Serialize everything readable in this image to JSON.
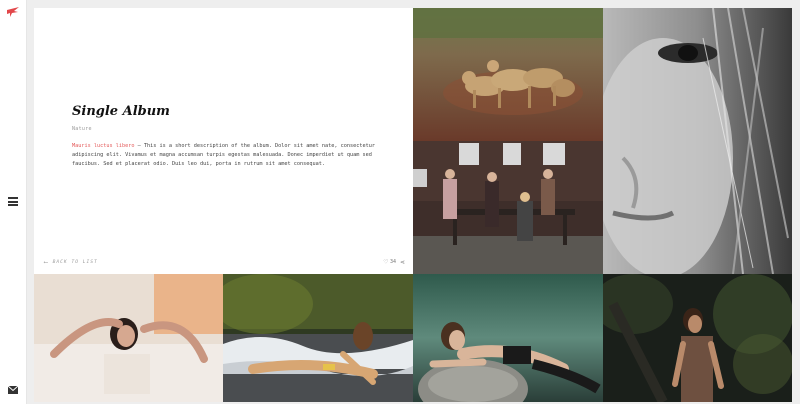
{
  "album": {
    "title": "Single Album",
    "category": "Nature",
    "description_lead": "Mauris luctus libero",
    "description_body": " – This is a short description of the album. Dolor sit amet nate, consectetur adipiscing elit. Vivamus et magna accumsan turpis egestas malesuada. Donec imperdiet ut quam sed faucibus. Sed et placerat odio. Duis leo dui, porta in rutrum sit amet consequat.",
    "back_label": "BACK TO LIST",
    "likes": "34"
  },
  "colors": {
    "accent": "#e45a5a",
    "logo": "#e2474a"
  },
  "icons": {
    "logo": "bird-logo-icon",
    "menu": "hamburger-menu-icon",
    "mail": "envelope-icon",
    "back": "arrow-left-icon",
    "like": "heart-icon",
    "share": "share-icon"
  },
  "photos": [
    {
      "name": "lions"
    },
    {
      "name": "group"
    },
    {
      "name": "face"
    },
    {
      "name": "bath"
    },
    {
      "name": "beach"
    },
    {
      "name": "rock"
    },
    {
      "name": "forest"
    }
  ]
}
